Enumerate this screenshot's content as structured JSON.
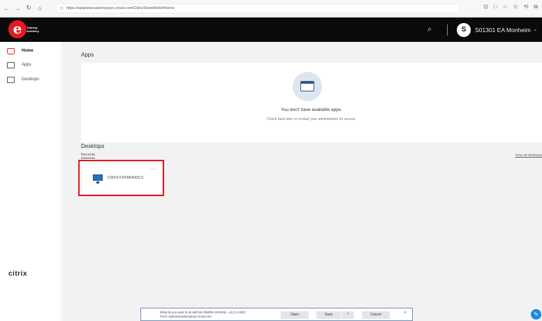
{
  "browser": {
    "url": "https://eplanetacademyacpc.cloud.com/Citrix/StoreWeb/#/home",
    "nav": {
      "back": "←",
      "forward": "→",
      "refresh": "↻",
      "home": "⌂"
    },
    "right_icons": [
      "⊡",
      "□",
      "☆",
      "✩",
      "⟲",
      "⧉",
      "⋯"
    ]
  },
  "header": {
    "logo": {
      "letter": "e",
      "line1": "Training",
      "line2": "Academy"
    },
    "search_icon": "⌕",
    "avatar_initial": "S",
    "username": "S01301 EA Monheim",
    "chevron": "⌄"
  },
  "sidebar": {
    "items": [
      {
        "label": "Home",
        "icon": "home-icon",
        "active": true
      },
      {
        "label": "Apps",
        "icon": "apps-icon",
        "active": false
      },
      {
        "label": "Desktops",
        "icon": "desktop-icon",
        "active": false
      }
    ],
    "brand": "citrix"
  },
  "main": {
    "apps_title": "Apps",
    "empty_title": "You don't have available apps.",
    "empty_sub": "Check back later or contact your administrator for access.",
    "desktops_title": "Desktops",
    "recents_tab": "Recents",
    "view_all": "View all desktops",
    "desktop_card": {
      "label": "CW19-FDFMHM2C3",
      "more": "···"
    }
  },
  "download": {
    "line1": "What do you want to do with NH-INWRK-WVNGIL...ca (1.4 KB)?",
    "line2": "From: eplanetacademyacpc.cloud.com",
    "open": "Open",
    "save": "Save",
    "save_chevron": "^",
    "cancel": "Cancel",
    "close": "×"
  },
  "feedback_icon": "✎",
  "colors": {
    "accent": "#e31b23",
    "header_bg": "#0a0a0a",
    "highlight": "#e0141e",
    "download_border": "#6d8fb3"
  }
}
